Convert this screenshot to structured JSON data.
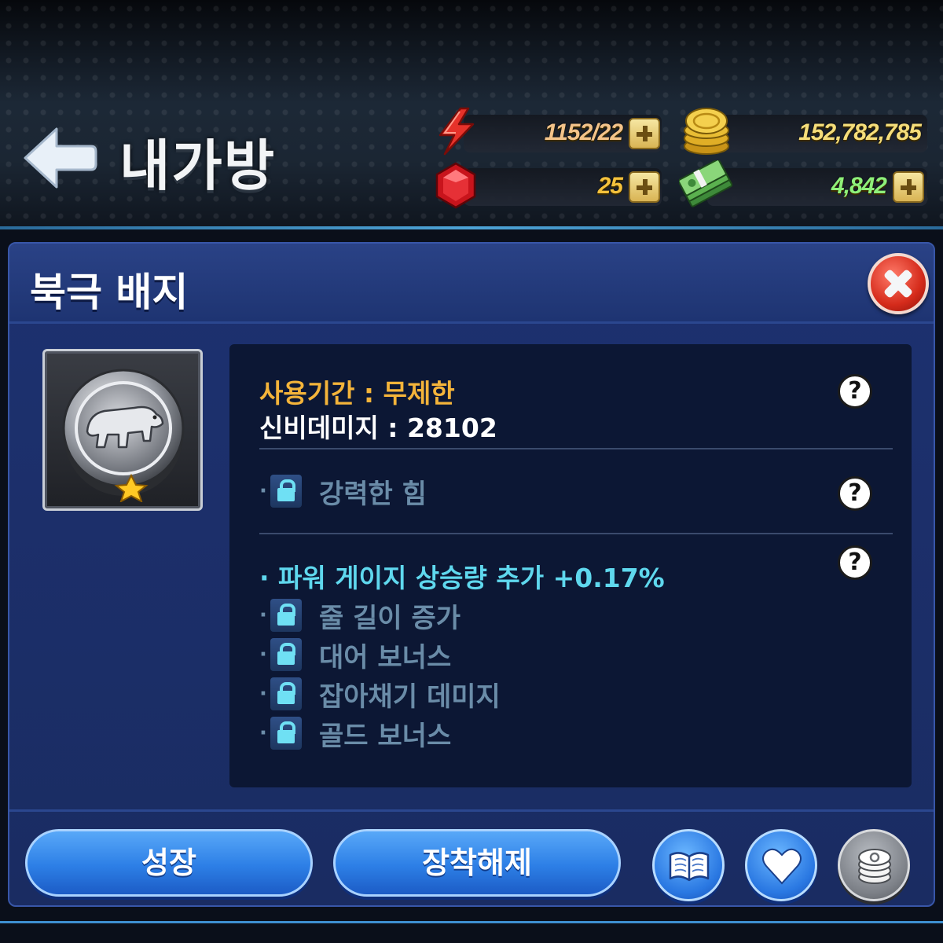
{
  "header": {
    "title": "내가방",
    "resources": {
      "energy": {
        "value": "1152/22",
        "icon": "lightning-icon"
      },
      "gold": {
        "value": "152,782,785",
        "icon": "gold-coins-icon"
      },
      "gem": {
        "value": "25",
        "icon": "red-gem-icon"
      },
      "cash": {
        "value": "4,842",
        "icon": "cash-stack-icon"
      }
    },
    "colors": {
      "energy": "#f3c38a",
      "gold": "#f5dd7a",
      "gem": "#f5c23c",
      "cash": "#8ef07a"
    }
  },
  "panel": {
    "title": "북극 배지",
    "badge": {
      "icon": "polar-bear-badge-icon",
      "stars": 1
    },
    "usage_period": "사용기간 : 무제한",
    "mystic_damage": "신비데미지 : 28102",
    "help_symbol": "?",
    "locked_option_1": "강력한 힘",
    "active_option": "파워 게이지 상승량 추가 +0.17%",
    "locked_options": [
      "줄 길이 증가",
      "대어 보너스",
      "잡아채기 데미지",
      "골드 보너스"
    ]
  },
  "buttons": {
    "grow": "성장",
    "unequip": "장착해제"
  }
}
